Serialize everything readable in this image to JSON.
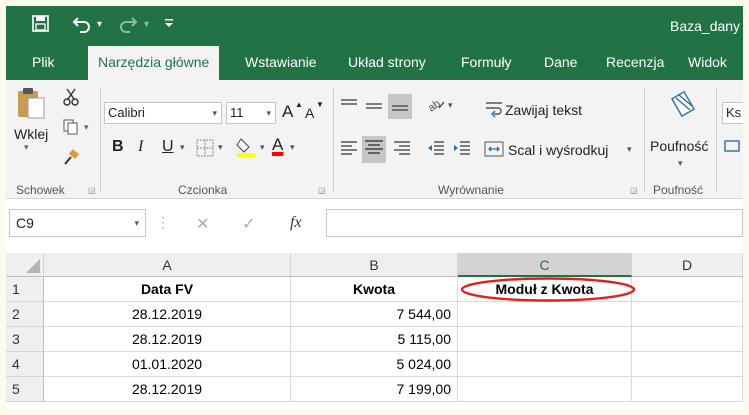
{
  "quick_access": {
    "save_icon": "save-icon",
    "undo_icon": "undo-icon",
    "redo_icon": "redo-icon",
    "customize_icon": "customize-icon"
  },
  "window": {
    "filename": "Baza_dany"
  },
  "tabs": [
    {
      "label": "Plik",
      "active": false
    },
    {
      "label": "Narzędzia główne",
      "active": true
    },
    {
      "label": "Wstawianie",
      "active": false
    },
    {
      "label": "Układ strony",
      "active": false
    },
    {
      "label": "Formuły",
      "active": false
    },
    {
      "label": "Dane",
      "active": false
    },
    {
      "label": "Recenzja",
      "active": false
    },
    {
      "label": "Widok",
      "active": false
    }
  ],
  "ribbon": {
    "clipboard": {
      "paste_label": "Wklej",
      "group_label": "Schowek"
    },
    "font": {
      "font_name": "Calibri",
      "font_size": "11",
      "grow": "A",
      "shrink": "A",
      "bold": "B",
      "italic": "I",
      "underline": "U",
      "font_color_letter": "A",
      "group_label": "Czcionka",
      "fill_color": "#ffff00",
      "font_color": "#ff0000"
    },
    "alignment": {
      "wrap_text": "Zawijaj tekst",
      "merge_center": "Scal i wyśrodkuj",
      "group_label": "Wyrównanie"
    },
    "sensitivity": {
      "label": "Poufność",
      "group_label": "Poufność"
    },
    "next_style": "Ks"
  },
  "formula_bar": {
    "name_box": "C9",
    "cancel": "✕",
    "enter": "✓",
    "fx": "fx",
    "value": ""
  },
  "sheet": {
    "columns": [
      "A",
      "B",
      "C",
      "D"
    ],
    "selected_column": "C",
    "rows": [
      {
        "num": "1",
        "a": "Data FV",
        "b": "Kwota",
        "c": "Moduł z Kwota"
      },
      {
        "num": "2",
        "a": "28.12.2019",
        "b": "7 544,00",
        "c": ""
      },
      {
        "num": "3",
        "a": "28.12.2019",
        "b": "5 115,00",
        "c": ""
      },
      {
        "num": "4",
        "a": "01.01.2020",
        "b": "5 024,00",
        "c": ""
      },
      {
        "num": "5",
        "a": "28.12.2019",
        "b": "7 199,00",
        "c": ""
      }
    ],
    "highlight_color": "#e0201c"
  }
}
